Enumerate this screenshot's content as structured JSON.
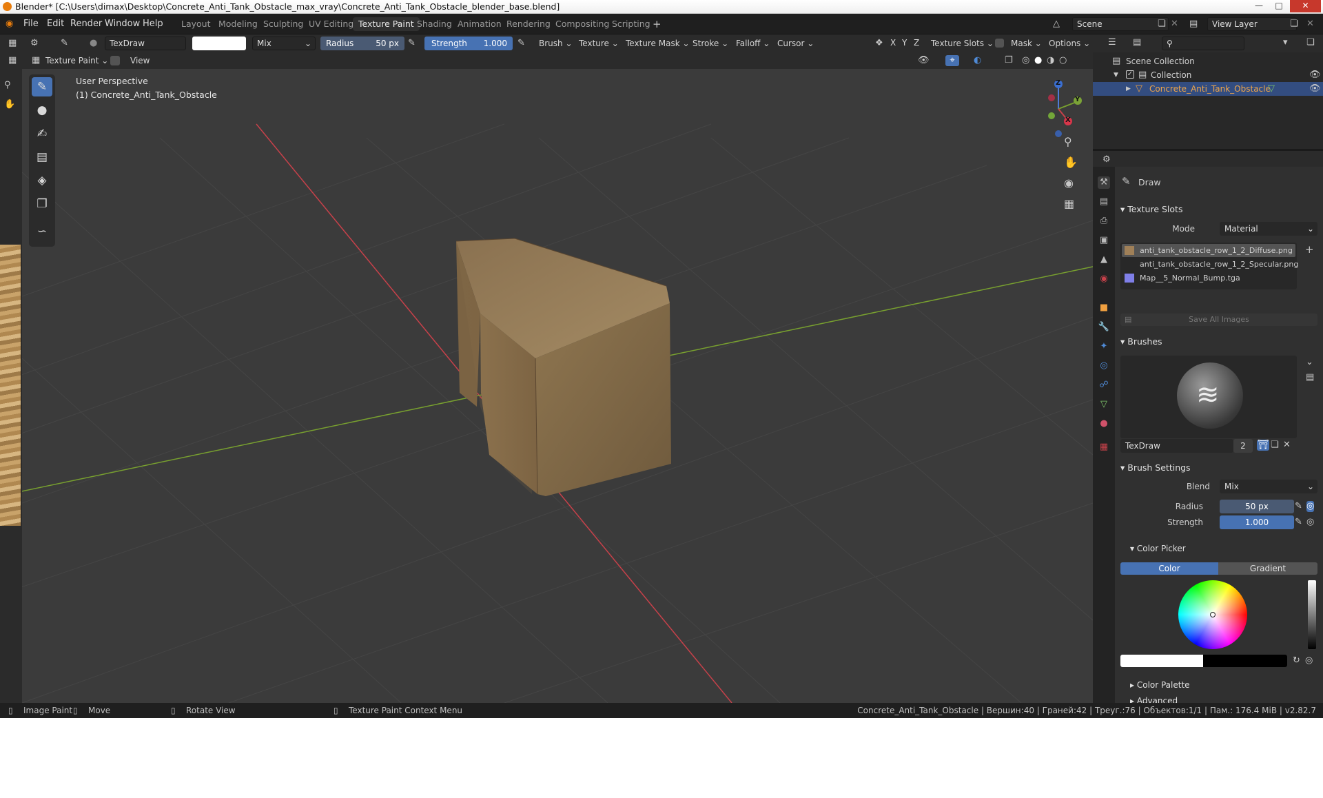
{
  "window": {
    "title": "Blender* [C:\\Users\\dimax\\Desktop\\Concrete_Anti_Tank_Obstacle_max_vray\\Concrete_Anti_Tank_Obstacle_blender_base.blend]"
  },
  "menu": [
    "File",
    "Edit",
    "Render",
    "Window",
    "Help"
  ],
  "workspaces": [
    "Layout",
    "Modeling",
    "Sculpting",
    "UV Editing",
    "Texture Paint",
    "Shading",
    "Animation",
    "Rendering",
    "Compositing",
    "Scripting"
  ],
  "active_workspace": "Texture Paint",
  "scene": {
    "name": "Scene",
    "view_layer": "View Layer"
  },
  "tool_header": {
    "brush_name": "TexDraw",
    "blend": "Mix",
    "radius_label": "Radius",
    "radius_value": "50 px",
    "strength_label": "Strength",
    "strength_value": "1.000",
    "dropdowns": [
      "Brush",
      "Texture",
      "Texture Mask",
      "Stroke",
      "Falloff",
      "Cursor"
    ],
    "axes": [
      "X",
      "Y",
      "Z"
    ],
    "texture_slots": "Texture Slots",
    "mask": "Mask",
    "options": "Options"
  },
  "view_header": {
    "mode": "Texture Paint",
    "view": "View"
  },
  "viewport": {
    "perspective": "User Perspective",
    "object_label": "(1) Concrete_Anti_Tank_Obstacle",
    "gizmo": {
      "x": "X",
      "y": "Y",
      "z": "Z"
    }
  },
  "outliner": {
    "scene_collection": "Scene Collection",
    "collection": "Collection",
    "object": "Concrete_Anti_Tank_Obstacle"
  },
  "properties": {
    "tool_name": "Draw",
    "texture_slots": {
      "title": "Texture Slots",
      "mode_label": "Mode",
      "mode_value": "Material",
      "slots": [
        "anti_tank_obstacle_row_1_2_Diffuse.png",
        "anti_tank_obstacle_row_1_2_Specular.png",
        "Map__5_Normal_Bump.tga"
      ],
      "save_all": "Save All Images"
    },
    "brushes": {
      "title": "Brushes",
      "brush_name": "TexDraw",
      "users": "2"
    },
    "brush_settings": {
      "title": "Brush Settings",
      "blend_label": "Blend",
      "blend_value": "Mix",
      "radius_label": "Radius",
      "radius_value": "50 px",
      "strength_label": "Strength",
      "strength_value": "1.000"
    },
    "color_picker": {
      "title": "Color Picker",
      "tab_color": "Color",
      "tab_gradient": "Gradient"
    },
    "color_palette": "Color Palette",
    "advanced": "Advanced"
  },
  "status_bar": {
    "left": [
      {
        "icon": "mouse-left-icon",
        "label": "Image Paint"
      },
      {
        "icon": "mouse-move-icon",
        "label": "Move"
      },
      {
        "icon": "mouse-middle-icon",
        "label": "Rotate View"
      },
      {
        "icon": "mouse-right-icon",
        "label": "Texture Paint Context Menu"
      }
    ],
    "right": "Concrete_Anti_Tank_Obstacle | Вершин:40 | Граней:42 | Треуг.:76 | Объектов:1/1 | Пам.: 176.4 MiB | v2.82.7"
  },
  "colors": {
    "accent": "#4772b3",
    "header": "#2b2b2b",
    "viewport": "#3b3b3b",
    "x_axis": "#c8414a",
    "y_axis": "#78a02f"
  }
}
